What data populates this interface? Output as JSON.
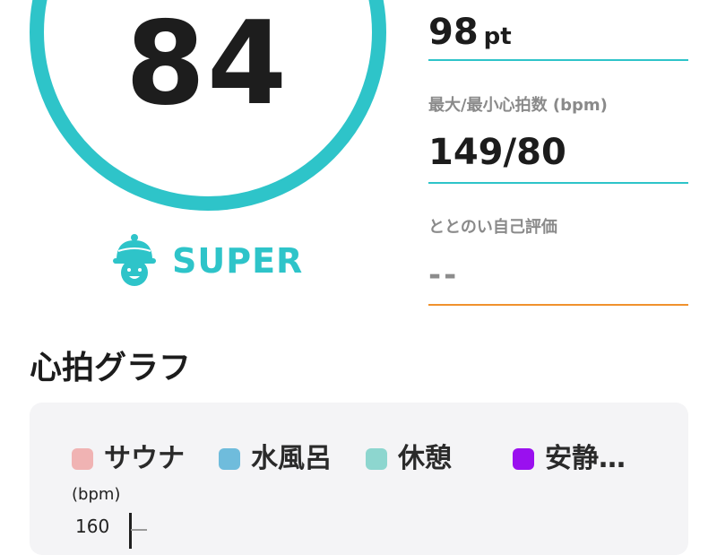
{
  "score": {
    "value": "84",
    "rank_label": "SUPER",
    "ring_color": "#2ec4c9",
    "rank_icon": "sauna-hat-mascot-icon"
  },
  "stats": {
    "points": {
      "value": "98",
      "unit": "pt"
    },
    "heart_rate": {
      "title": "最大/最小心拍数 (bpm)",
      "value": "149/80"
    },
    "self_rating": {
      "title": "ととのい自己評価",
      "value": "--"
    }
  },
  "graph": {
    "title": "心拍グラフ",
    "legend": [
      {
        "label": "サウナ",
        "color": "#f0b3b3"
      },
      {
        "label": "水風呂",
        "color": "#6fbcdc"
      },
      {
        "label": "休憩",
        "color": "#8dd6cf"
      },
      {
        "label": "安静…",
        "color": "#9a10ef"
      }
    ],
    "y_axis_unit": "(bpm)",
    "y_tick": "160"
  },
  "colors": {
    "accent": "#2ec4c9",
    "warning": "#f0922d"
  }
}
